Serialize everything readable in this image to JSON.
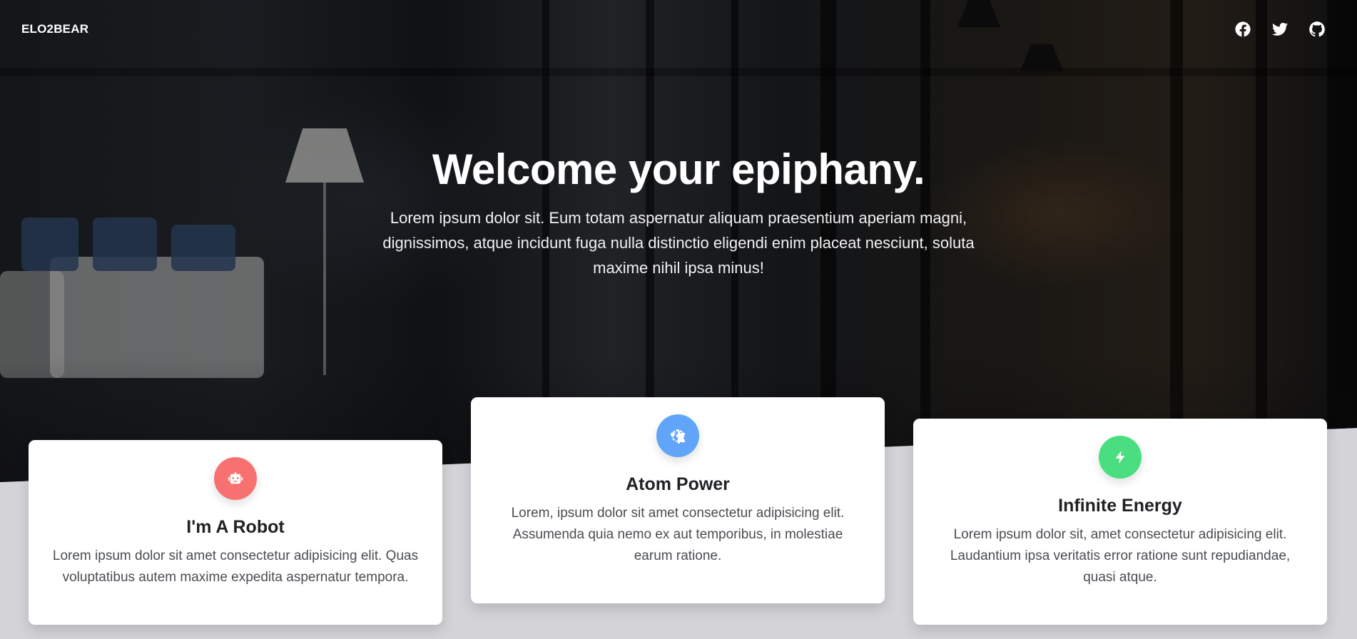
{
  "nav": {
    "brand": "ELO2BEAR",
    "social": [
      {
        "icon": "facebook-icon"
      },
      {
        "icon": "twitter-icon"
      },
      {
        "icon": "github-icon"
      }
    ]
  },
  "hero": {
    "title": "Welcome your epiphany.",
    "subtitle": "Lorem ipsum dolor sit. Eum totam aspernatur aliquam praesentium aperiam magni, dignissimos, atque incidunt fuga nulla distinctio eligendi enim placeat nesciunt, soluta maxime nihil ipsa minus!"
  },
  "cards": [
    {
      "icon": "robot-icon",
      "icon_color": "#f87171",
      "title": "I'm A Robot",
      "body": "Lorem ipsum dolor sit amet consectetur adipisicing elit. Quas voluptatibus autem maxime expedita aspernatur tempora."
    },
    {
      "icon": "atom-icon",
      "icon_color": "#60a5fa",
      "title": "Atom Power",
      "body": "Lorem, ipsum dolor sit amet consectetur adipisicing elit. Assumenda quia nemo ex aut temporibus, in molestiae earum ratione."
    },
    {
      "icon": "bolt-icon",
      "icon_color": "#4ade80",
      "title": "Infinite Energy",
      "body": "Lorem ipsum dolor sit, amet consectetur adipisicing elit. Laudantium ipsa veritatis error ratione sunt repudiandae, quasi atque."
    }
  ],
  "colors": {
    "page_background": "#d4d4d8",
    "card_background": "#ffffff"
  }
}
